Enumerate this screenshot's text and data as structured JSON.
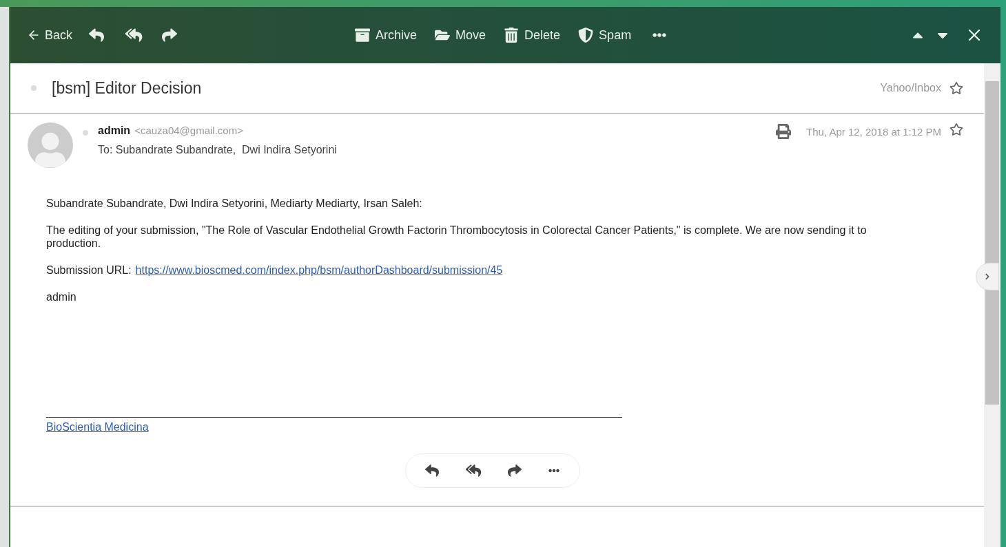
{
  "toolbar": {
    "back": "Back",
    "actions": [
      {
        "kind": "archive",
        "label": "Archive"
      },
      {
        "kind": "move",
        "label": "Move"
      },
      {
        "kind": "delete",
        "label": "Delete"
      },
      {
        "kind": "spam",
        "label": "Spam"
      }
    ]
  },
  "subject": {
    "title": "[bsm] Editor Decision",
    "folder": "Yahoo/Inbox",
    "starred": false
  },
  "message": {
    "sender": "admin",
    "email": "<cauza04@gmail.com>",
    "to": "To: Subandrate Subandrate,  Dwi Indira Setyorini",
    "date": "Thu, Apr 12, 2018 at 1:12 PM",
    "starred": false,
    "body": [
      {
        "kind": "text",
        "text": "Subandrate Subandrate, Dwi Indira Setyorini, Mediarty Mediarty, Irsan Saleh:"
      },
      {
        "kind": "text",
        "text": "The editing of your submission, \"The Role of Vascular Endothelial Growth Factorin Thrombocytosis in Colorectal Cancer Patients,\" is complete. We are now sending it to production."
      },
      {
        "kind": "link",
        "text": "Submission URL:",
        "link": "https://www.bioscmed.com/index.php/bsm/authorDashboard/submission/45"
      },
      {
        "kind": "text",
        "text": "admin"
      }
    ],
    "footer_link": "BioScientia Medicina"
  }
}
